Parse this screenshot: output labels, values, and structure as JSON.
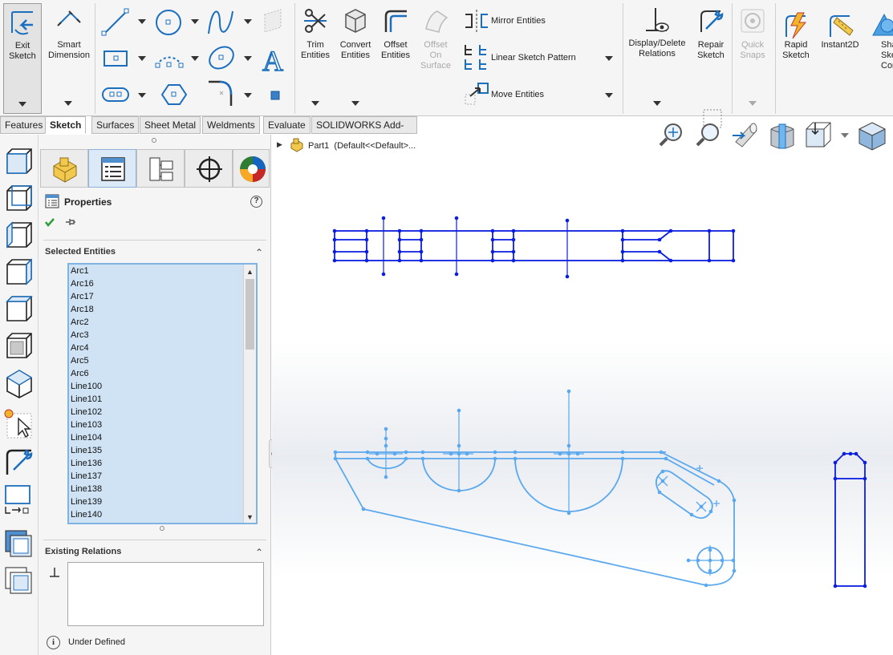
{
  "ribbon": {
    "exit_sketch": "Exit\nSketch",
    "smart_dimension": "Smart\nDimension",
    "trim_entities": "Trim\nEntities",
    "convert_entities": "Convert\nEntities",
    "offset_entities": "Offset\nEntities",
    "offset_on_surface": "Offset\nOn\nSurface",
    "mirror_entities": "Mirror Entities",
    "linear_sketch_pattern": "Linear Sketch Pattern",
    "move_entities": "Move Entities",
    "display_delete_relations": "Display/Delete\nRelations",
    "repair_sketch": "Repair\nSketch",
    "quick_snaps": "Quick\nSnaps",
    "rapid_sketch": "Rapid\nSketch",
    "instant2d": "Instant2D",
    "shaded_sketch_contours": "Shad\nSketc\nConto"
  },
  "tabs": [
    "Features",
    "Sketch",
    "Surfaces",
    "Sheet Metal",
    "Weldments",
    "Evaluate",
    "SOLIDWORKS Add-Ins"
  ],
  "active_tab": "Sketch",
  "property_manager": {
    "title": "Properties",
    "help_glyph": "?",
    "selected_entities_title": "Selected Entities",
    "selected_entities": [
      "Arc1",
      "Arc16",
      "Arc17",
      "Arc18",
      "Arc2",
      "Arc3",
      "Arc4",
      "Arc5",
      "Arc6",
      "Line100",
      "Line101",
      "Line102",
      "Line103",
      "Line104",
      "Line135",
      "Line136",
      "Line137",
      "Line138",
      "Line139",
      "Line140"
    ],
    "existing_relations_title": "Existing Relations",
    "status": "Under Defined"
  },
  "feature_tree": {
    "part_label": "Part1",
    "config_label": "(Default<<Default>..."
  },
  "colors": {
    "sketch_blue": "#0a1ee0",
    "selected_blue": "#5aa8ee",
    "accent": "#1c6fbf"
  },
  "icons": [
    "exit-sketch-icon",
    "smart-dimension-icon",
    "line-icon",
    "circle-icon",
    "spline-icon",
    "rectangle-icon",
    "arc-icon",
    "ellipse-icon",
    "text-icon",
    "slot-icon",
    "polygon-icon",
    "fillet-icon",
    "point-icon",
    "trim-icon",
    "convert-icon",
    "offset-icon",
    "mirror-icon",
    "pattern-icon",
    "move-icon",
    "relations-icon",
    "repair-icon",
    "quick-snaps-icon",
    "rapid-sketch-icon",
    "instant2d-icon",
    "shaded-sketch-icon"
  ]
}
